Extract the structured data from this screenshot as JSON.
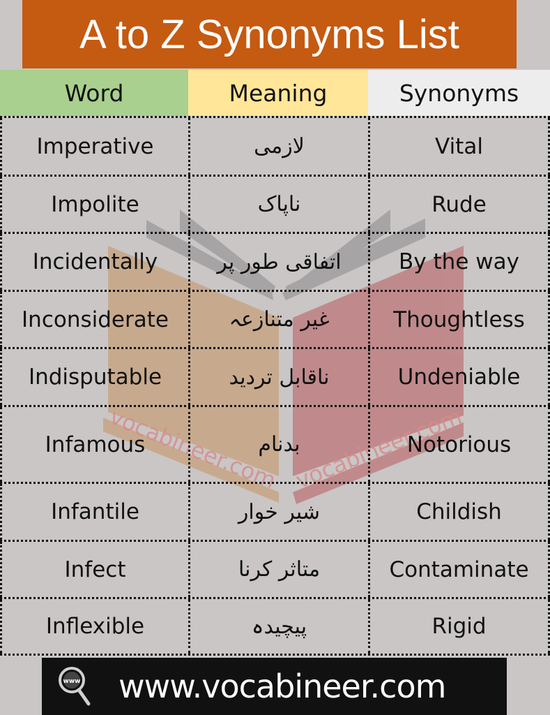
{
  "title": "A to Z Synonyms List",
  "colors": {
    "title_bg": "#c55a11",
    "word_header_bg": "#a9d08e",
    "meaning_header_bg": "#ffe699",
    "synonyms_header_bg": "#ededed",
    "page_bg": "#c9c6c5",
    "footer_bg": "#111111"
  },
  "headers": {
    "word": "Word",
    "meaning": "Meaning",
    "synonyms": "Synonyms"
  },
  "rows": [
    {
      "word": "Imperative",
      "meaning": "لازمی",
      "synonym": "Vital"
    },
    {
      "word": "Impolite",
      "meaning": "ناپاک",
      "synonym": "Rude"
    },
    {
      "word": "Incidentally",
      "meaning": "اتفاقی طور پر",
      "synonym": "By the way"
    },
    {
      "word": "Inconsiderate",
      "meaning": "غیر متنازعہ",
      "synonym": "Thoughtless"
    },
    {
      "word": "Indisputable",
      "meaning": "ناقابل تردید",
      "synonym": "Undeniable"
    },
    {
      "word": "Infamous",
      "meaning": "بدنام",
      "synonym": "Notorious"
    },
    {
      "word": "Infantile",
      "meaning": "شیر خوار",
      "synonym": "Childish"
    },
    {
      "word": "Infect",
      "meaning": "متاثر کرنا",
      "synonym": "Contaminate"
    },
    {
      "word": "Inflexible",
      "meaning": "پیچیدہ",
      "synonym": "Rigid"
    }
  ],
  "watermark": {
    "text_left": "vocabineer.com",
    "text_right": "vocabineer.com",
    "icon": "open-book-icon"
  },
  "footer": {
    "icon": "www-magnifier-icon",
    "icon_text": "www",
    "url": "www.vocabineer.com"
  }
}
